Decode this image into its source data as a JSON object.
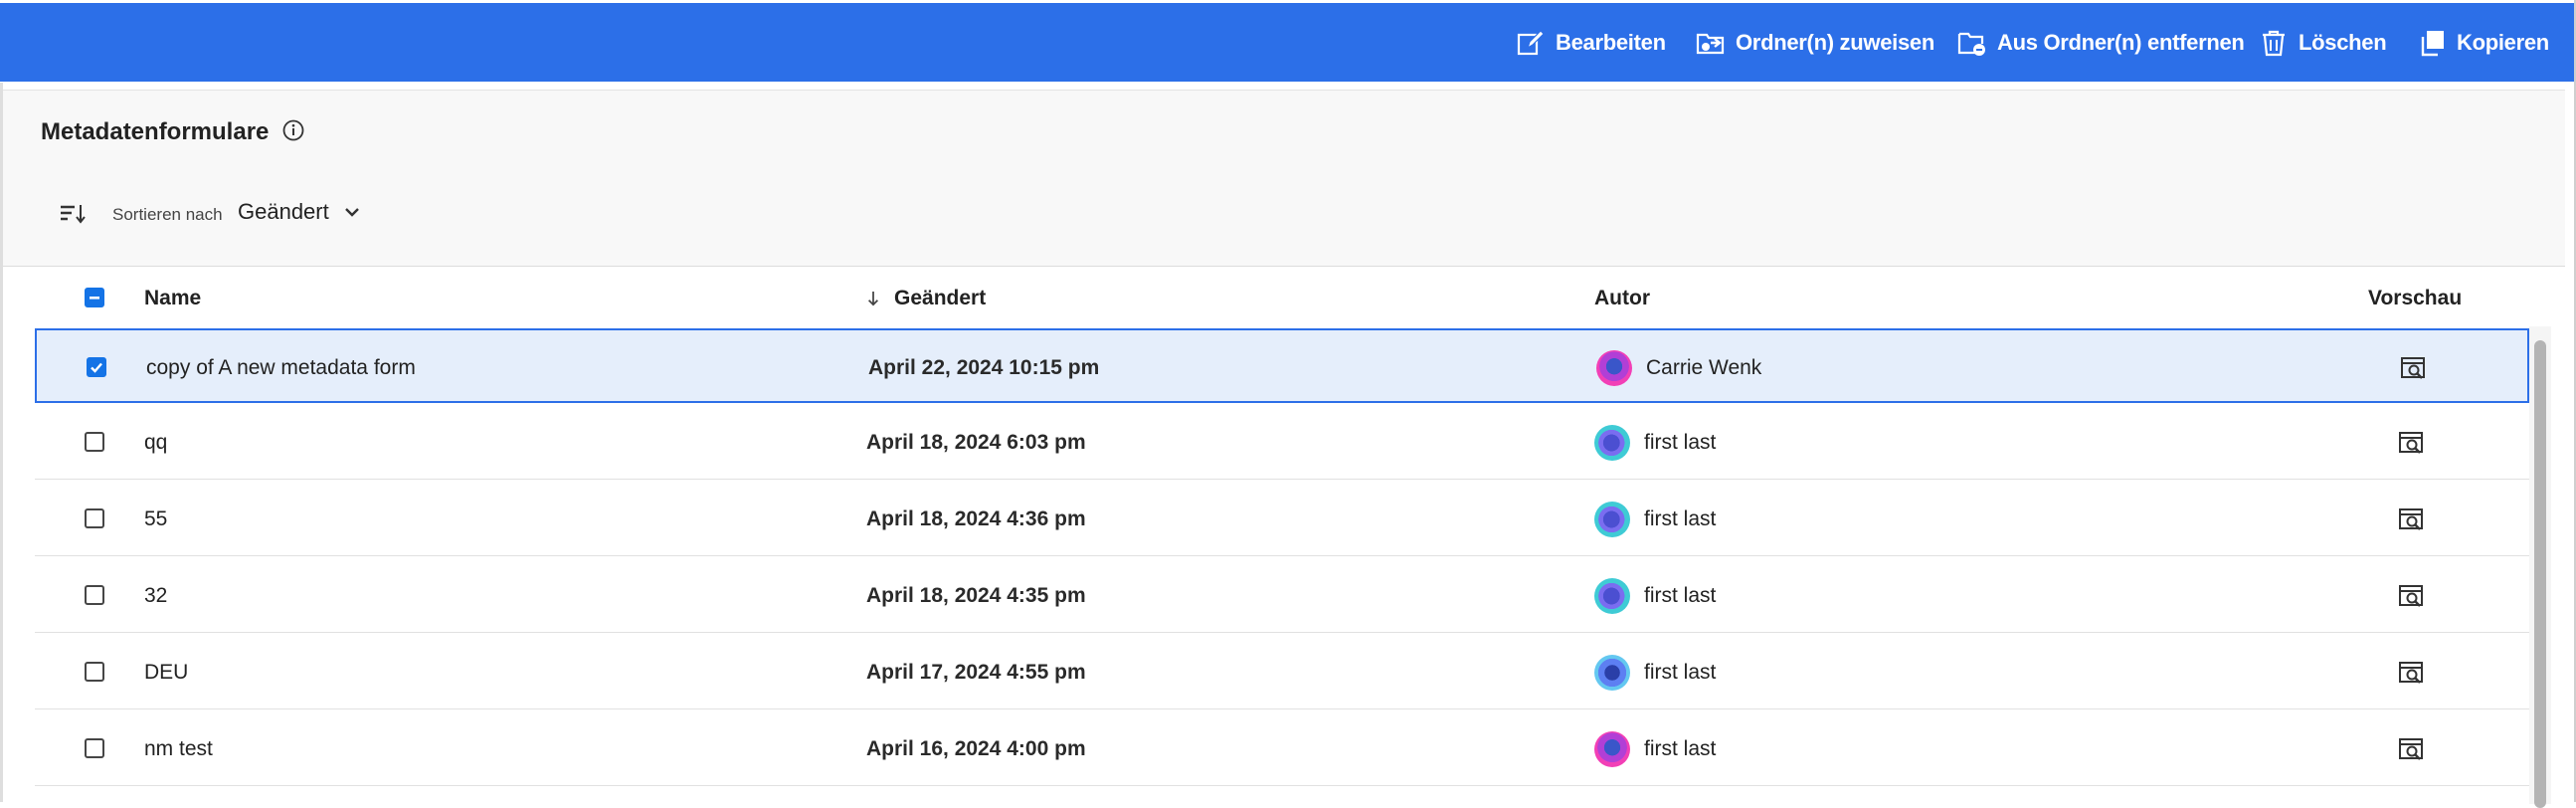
{
  "toolbar": {
    "actions": [
      {
        "label": "Bearbeiten",
        "icon": "edit-icon"
      },
      {
        "label": "Ordner(n) zuweisen",
        "icon": "folder-assign-icon"
      },
      {
        "label": "Aus Ordner(n) entfernen",
        "icon": "folder-remove-icon"
      },
      {
        "label": "Löschen",
        "icon": "trash-icon"
      },
      {
        "label": "Kopieren",
        "icon": "copy-icon"
      }
    ],
    "color": "#2c6fe8"
  },
  "page": {
    "title": "Metadatenformulare",
    "sort_label": "Sortieren nach",
    "sort_value": "Geändert"
  },
  "table": {
    "columns": {
      "name": "Name",
      "modified": "Geändert",
      "author": "Autor",
      "preview": "Vorschau"
    },
    "select_all_state": "mixed",
    "rows": [
      {
        "name": "copy of A new metadata form",
        "modified": "April 22, 2024 10:15 pm",
        "author": "Carrie Wenk",
        "selected": true,
        "avatar": "pink"
      },
      {
        "name": "qq",
        "modified": "April 18, 2024 6:03 pm",
        "author": "first last",
        "selected": false,
        "avatar": "teal"
      },
      {
        "name": "55",
        "modified": "April 18, 2024 4:36 pm",
        "author": "first last",
        "selected": false,
        "avatar": "teal"
      },
      {
        "name": "32",
        "modified": "April 18, 2024 4:35 pm",
        "author": "first last",
        "selected": false,
        "avatar": "teal"
      },
      {
        "name": "DEU",
        "modified": "April 17, 2024 4:55 pm",
        "author": "first last",
        "selected": false,
        "avatar": "blue"
      },
      {
        "name": "nm test",
        "modified": "April 16, 2024 4:00 pm",
        "author": "first last",
        "selected": false,
        "avatar": "pink"
      }
    ]
  },
  "colors": {
    "accent": "#2c6fe8",
    "selected_row": "#e5eefb",
    "checkbox": "#1473e6"
  }
}
